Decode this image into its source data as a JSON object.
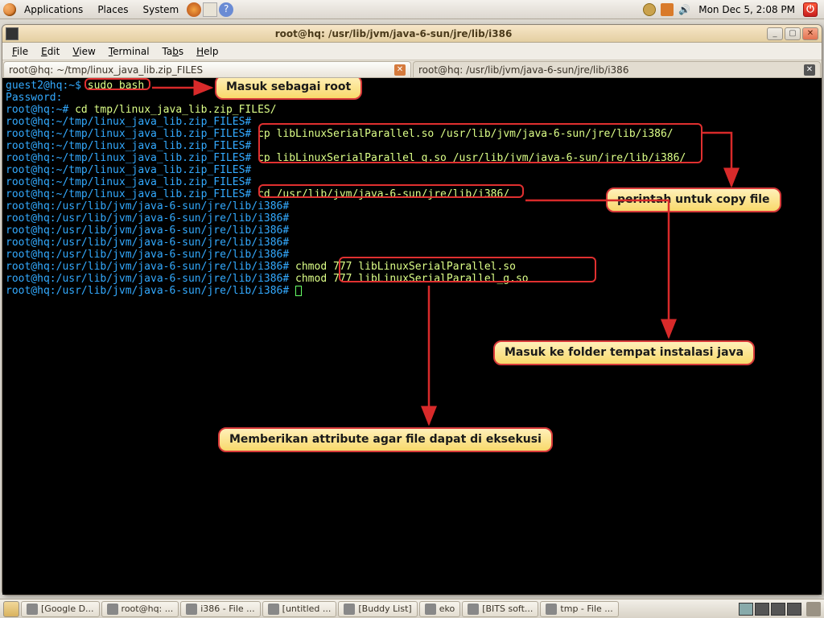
{
  "topbar": {
    "menu": [
      "Applications",
      "Places",
      "System"
    ],
    "clock": "Mon Dec  5,  2:08 PM"
  },
  "window": {
    "title": "root@hq: /usr/lib/jvm/java-6-sun/jre/lib/i386"
  },
  "menubar": {
    "file": "File",
    "edit": "Edit",
    "view": "View",
    "terminal": "Terminal",
    "tabs": "Tabs",
    "help": "Help"
  },
  "tabs": {
    "active": "root@hq: ~/tmp/linux_java_lib.zip_FILES",
    "inactive": "root@hq: /usr/lib/jvm/java-6-sun/jre/lib/i386"
  },
  "terminal": {
    "lines": [
      {
        "p": "guest2@hq:~$",
        "c": " sudo bash"
      },
      {
        "p": "Password:",
        "c": ""
      },
      {
        "p": "root@hq:~#",
        "c": " cd tmp/linux_java_lib.zip_FILES/"
      },
      {
        "p": "root@hq:~/tmp/linux_java_lib.zip_FILES#",
        "c": ""
      },
      {
        "p": "root@hq:~/tmp/linux_java_lib.zip_FILES#",
        "c": " cp libLinuxSerialParallel.so /usr/lib/jvm/java-6-sun/jre/lib/i386/"
      },
      {
        "p": "root@hq:~/tmp/linux_java_lib.zip_FILES#",
        "c": ""
      },
      {
        "p": "root@hq:~/tmp/linux_java_lib.zip_FILES#",
        "c": " cp libLinuxSerialParallel_g.so /usr/lib/jvm/java-6-sun/jre/lib/i386/"
      },
      {
        "p": "root@hq:~/tmp/linux_java_lib.zip_FILES#",
        "c": ""
      },
      {
        "p": "root@hq:~/tmp/linux_java_lib.zip_FILES#",
        "c": ""
      },
      {
        "p": "root@hq:~/tmp/linux_java_lib.zip_FILES#",
        "c": " cd /usr/lib/jvm/java-6-sun/jre/lib/i386/"
      },
      {
        "p": "root@hq:/usr/lib/jvm/java-6-sun/jre/lib/i386#",
        "c": ""
      },
      {
        "p": "root@hq:/usr/lib/jvm/java-6-sun/jre/lib/i386#",
        "c": ""
      },
      {
        "p": "root@hq:/usr/lib/jvm/java-6-sun/jre/lib/i386#",
        "c": ""
      },
      {
        "p": "root@hq:/usr/lib/jvm/java-6-sun/jre/lib/i386#",
        "c": ""
      },
      {
        "p": "root@hq:/usr/lib/jvm/java-6-sun/jre/lib/i386#",
        "c": ""
      },
      {
        "p": "root@hq:/usr/lib/jvm/java-6-sun/jre/lib/i386#",
        "c": " chmod 777 libLinuxSerialParallel.so"
      },
      {
        "p": "root@hq:/usr/lib/jvm/java-6-sun/jre/lib/i386#",
        "c": " chmod 777 libLinuxSerialParallel_g.so"
      },
      {
        "p": "root@hq:/usr/lib/jvm/java-6-sun/jre/lib/i386#",
        "c": " "
      }
    ]
  },
  "callouts": {
    "sudo": "Masuk sebagai root",
    "copy": "perintah untuk copy file",
    "cd_java": "Masuk ke folder tempat instalasi java",
    "chmod": "Memberikan attribute agar file dapat di eksekusi"
  },
  "taskbar": {
    "items": [
      "[Google D...",
      "root@hq: ...",
      "i386 - File ...",
      "[untitled ...",
      "[Buddy List]",
      "eko",
      "[BITS soft...",
      "tmp - File ..."
    ]
  }
}
